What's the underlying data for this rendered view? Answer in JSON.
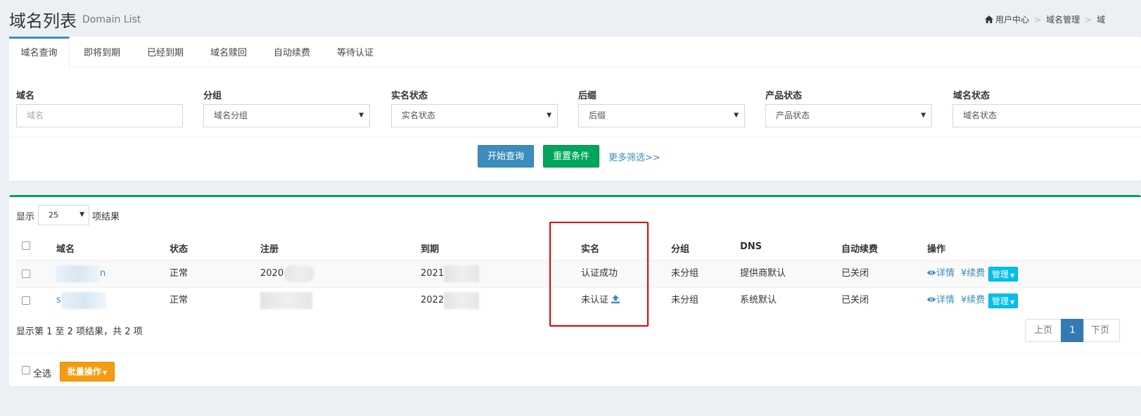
{
  "header": {
    "title": "域名列表",
    "subtitle": "Domain List",
    "breadcrumb": [
      "用户中心",
      "域名管理",
      "域"
    ]
  },
  "tabs": [
    "域名查询",
    "即将到期",
    "已经到期",
    "域名赎回",
    "自动续费",
    "等待认证"
  ],
  "active_tab": 0,
  "filters": [
    {
      "label": "域名",
      "placeholder": "域名",
      "type": "input"
    },
    {
      "label": "分组",
      "value": "域名分组",
      "type": "select"
    },
    {
      "label": "实名状态",
      "value": "实名状态",
      "type": "select"
    },
    {
      "label": "后缀",
      "value": "后缀",
      "type": "select"
    },
    {
      "label": "产品状态",
      "value": "产品状态",
      "type": "select"
    },
    {
      "label": "域名状态",
      "value": "域名状态",
      "type": "select"
    }
  ],
  "actions": {
    "search": "开始查询",
    "reset": "重置条件",
    "more": "更多筛选>>"
  },
  "length": {
    "prefix": "显示",
    "value": "25",
    "suffix": "项结果"
  },
  "columns": [
    "域名",
    "状态",
    "注册",
    "到期",
    "实名",
    "分组",
    "DNS",
    "自动续费",
    "操作"
  ],
  "rows": [
    {
      "domain": "n",
      "status": "正常",
      "registered": "2020",
      "expires": "2021",
      "realname": "认证成功",
      "group": "未分组",
      "dns": "提供商默认",
      "autorenew": "已关闭",
      "details": "详情",
      "renew": "¥续费",
      "manage": "管理"
    },
    {
      "domain": "s",
      "status": "正常",
      "registered": "",
      "expires": "2022",
      "realname": "未认证",
      "group": "未分组",
      "dns": "系统默认",
      "autorenew": "已关闭",
      "details": "详情",
      "renew": "¥续费",
      "manage": "管理"
    }
  ],
  "info": "显示第 1 至 2 项结果，共 2 项",
  "pagination": {
    "prev": "上页",
    "current": "1",
    "next": "下页"
  },
  "footer": {
    "select_all": "全选",
    "batch": "批量操作"
  },
  "colors": {
    "primary": "#3c8dbc",
    "success": "#00a65a",
    "info": "#00c0ef",
    "warning": "#f39c12",
    "highlight": "#e00000"
  },
  "icons": [
    "home-icon",
    "upload-icon",
    "eye-icon",
    "caret-down-icon"
  ]
}
